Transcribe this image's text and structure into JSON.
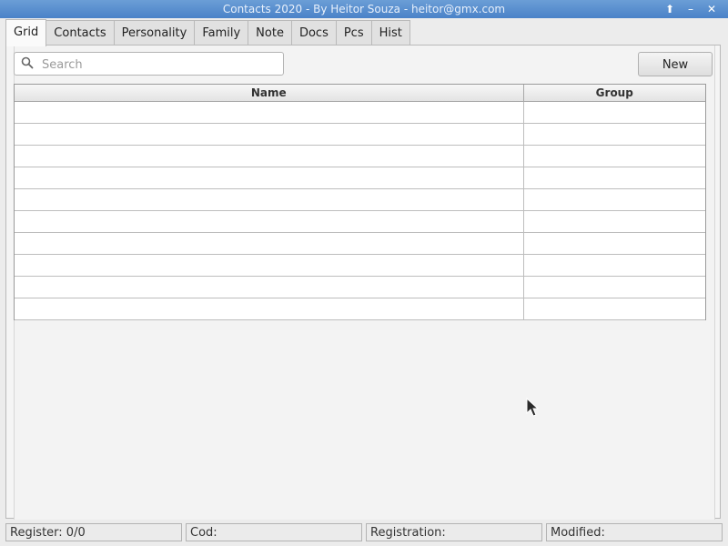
{
  "window": {
    "title": "Contacts 2020 - By Heitor Souza - heitor@gmx.com",
    "controls": {
      "up": "⬆",
      "minimize": "–",
      "close": "✕"
    }
  },
  "tabs": [
    {
      "label": "Grid",
      "active": true
    },
    {
      "label": "Contacts"
    },
    {
      "label": "Personality"
    },
    {
      "label": "Family"
    },
    {
      "label": "Note"
    },
    {
      "label": "Docs"
    },
    {
      "label": "Pcs"
    },
    {
      "label": "Hist"
    }
  ],
  "search": {
    "placeholder": "Search",
    "value": "",
    "icon": "search-icon"
  },
  "toolbar": {
    "new_label": "New"
  },
  "grid": {
    "columns": [
      "Name",
      "Group"
    ],
    "rows": [
      [
        "",
        ""
      ],
      [
        "",
        ""
      ],
      [
        "",
        ""
      ],
      [
        "",
        ""
      ],
      [
        "",
        ""
      ],
      [
        "",
        ""
      ],
      [
        "",
        ""
      ],
      [
        "",
        ""
      ],
      [
        "",
        ""
      ],
      [
        "",
        ""
      ]
    ]
  },
  "status": {
    "register": "Register: 0/0",
    "cod": "Cod:",
    "registration": "Registration:",
    "modified": "Modified:"
  },
  "colors": {
    "titlebar": "#4a82c8",
    "window_bg": "#ececec"
  }
}
